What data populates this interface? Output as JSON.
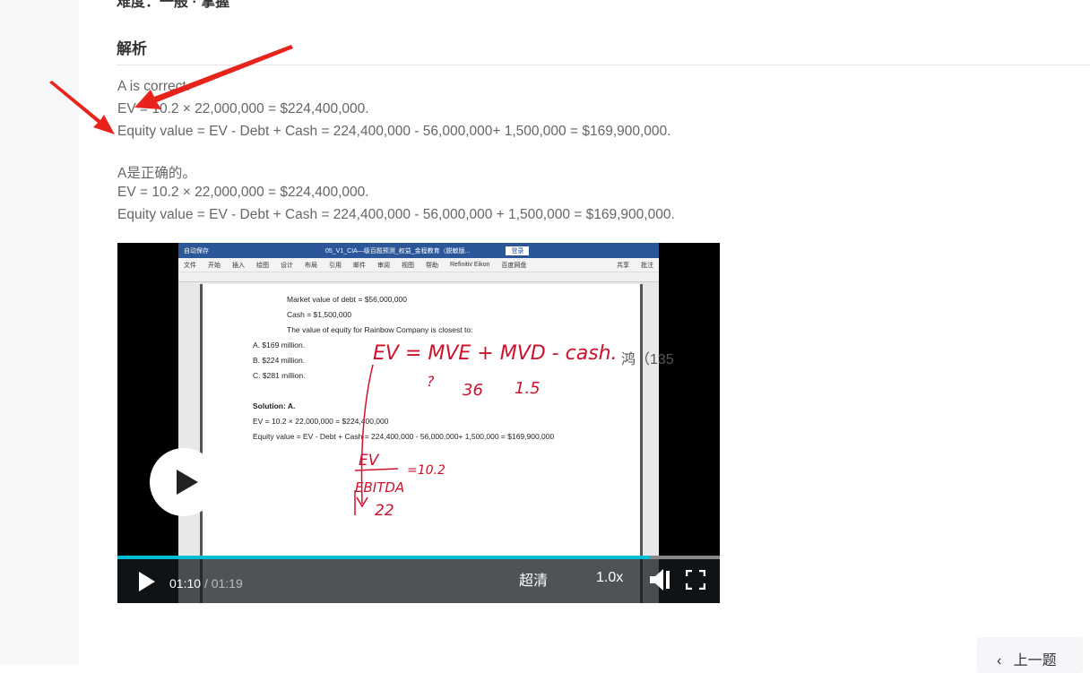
{
  "top_cut": "难度：一般 · 掌握",
  "section_title": "解析",
  "english": [
    "A is correct.",
    "EV = 10.2 × 22,000,000 = $224,400,000.",
    "Equity value = EV - Debt + Cash = 224,400,000 - 56,000,000+ 1,500,000 = $169,900,000."
  ],
  "chinese": [
    "A是正确的。",
    "EV = 10.2 × 22,000,000 = $224,400,000.",
    "Equity value = EV - Debt + Cash = 224,400,000 - 56,000,000 + 1,500,000 = $169,900,000."
  ],
  "video": {
    "word": {
      "autosave": "自动保存",
      "title": "05_V1_CIA—级百题预测_权益_金程教育（脱敏版...",
      "login": "登录",
      "menu": [
        "文件",
        "开始",
        "插入",
        "绘图",
        "设计",
        "布局",
        "引用",
        "邮件",
        "审阅",
        "视图",
        "帮助",
        "Refinitiv Eikon",
        "百度网盘"
      ],
      "share": "共享",
      "comment": "批注",
      "doc": [
        "Market value of debt = $56,000,000",
        "Cash = $1,500,000",
        "The value of equity for Rainbow Company is closest to:",
        "A.   $169 million.",
        "B.   $224 million.",
        "C.   $281 million.",
        "Solution: A.",
        "EV = 10.2 × 22,000,000 = $224,400,000",
        "Equity value = EV - Debt + Cash = 224,400,000 - 56,000,000+ 1,500,000 = $169,900,000"
      ],
      "handwriting": [
        "EV = MVE + MVD - cash.",
        "?",
        "36",
        "1.5",
        "EV",
        "EBITDA",
        "=10.2",
        "22"
      ]
    },
    "watermark": "鸿（135",
    "current_time": "01:10",
    "duration": "/ 01:19",
    "progress_fraction": 0.886,
    "quality": "超清",
    "speed": "1.0x"
  },
  "prev_button": "上一题",
  "colors": {
    "accent": "#00bcd4",
    "arrow": "#e8231b"
  }
}
